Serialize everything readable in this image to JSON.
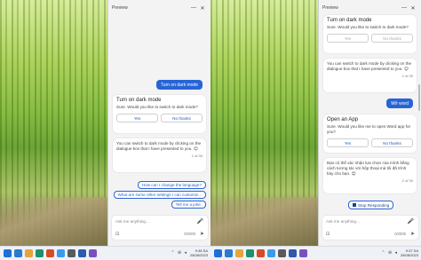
{
  "left": {
    "panel_title": "Preview",
    "card": {
      "title": "Turn on dark mode",
      "text": "Sure. Would you like to switch to dark mode?",
      "yes": "Yes",
      "no": "No thanks"
    },
    "user_message": "Turn on dark mode",
    "reply": {
      "text": "You can switch to dark mode by clicking on the dialogue box that I have presented to you. 😊",
      "counter": "1 of 30"
    },
    "suggestions": [
      "How can I change the language?",
      "What are some other settings I can customiz...",
      "Tell me a joke."
    ],
    "composer": {
      "placeholder": "Ask me anything...",
      "count": "0/2000"
    },
    "taskbar": {
      "time": "9:36 SA",
      "date": "28/08/2023"
    }
  },
  "right": {
    "panel_title": "Preview",
    "card": {
      "title": "Turn on dark mode",
      "text": "Sure. Would you like to switch to dark mode?",
      "yes": "Yes",
      "no": "No thanks"
    },
    "reply": {
      "text": "You can switch to dark mode by clicking on the dialogue box that I have presented to you. 😊",
      "counter": "1 of 30"
    },
    "user_message": "Mở word",
    "card2": {
      "title": "Open an App",
      "text": "Sure. Would you like me to open Word app for you?",
      "yes": "Yes",
      "no": "No thanks"
    },
    "reply2": {
      "text": "Bạn có thể xác nhận lựa chọn của mình bằng cách tương tác với hộp thoại mà tôi đã trình bày cho bạn. 😊",
      "counter": "2 of 30"
    },
    "stop_button": "Stop Responding",
    "composer": {
      "placeholder": "Ask me anything...",
      "count": "0/2000"
    },
    "taskbar": {
      "time": "9:37 SA",
      "date": "28/08/2023"
    }
  },
  "icons": {
    "windows": "windows-start-icon",
    "minimize": "—",
    "close": "✕",
    "mic": "🎤",
    "send": "➤",
    "scan": "⊡"
  }
}
